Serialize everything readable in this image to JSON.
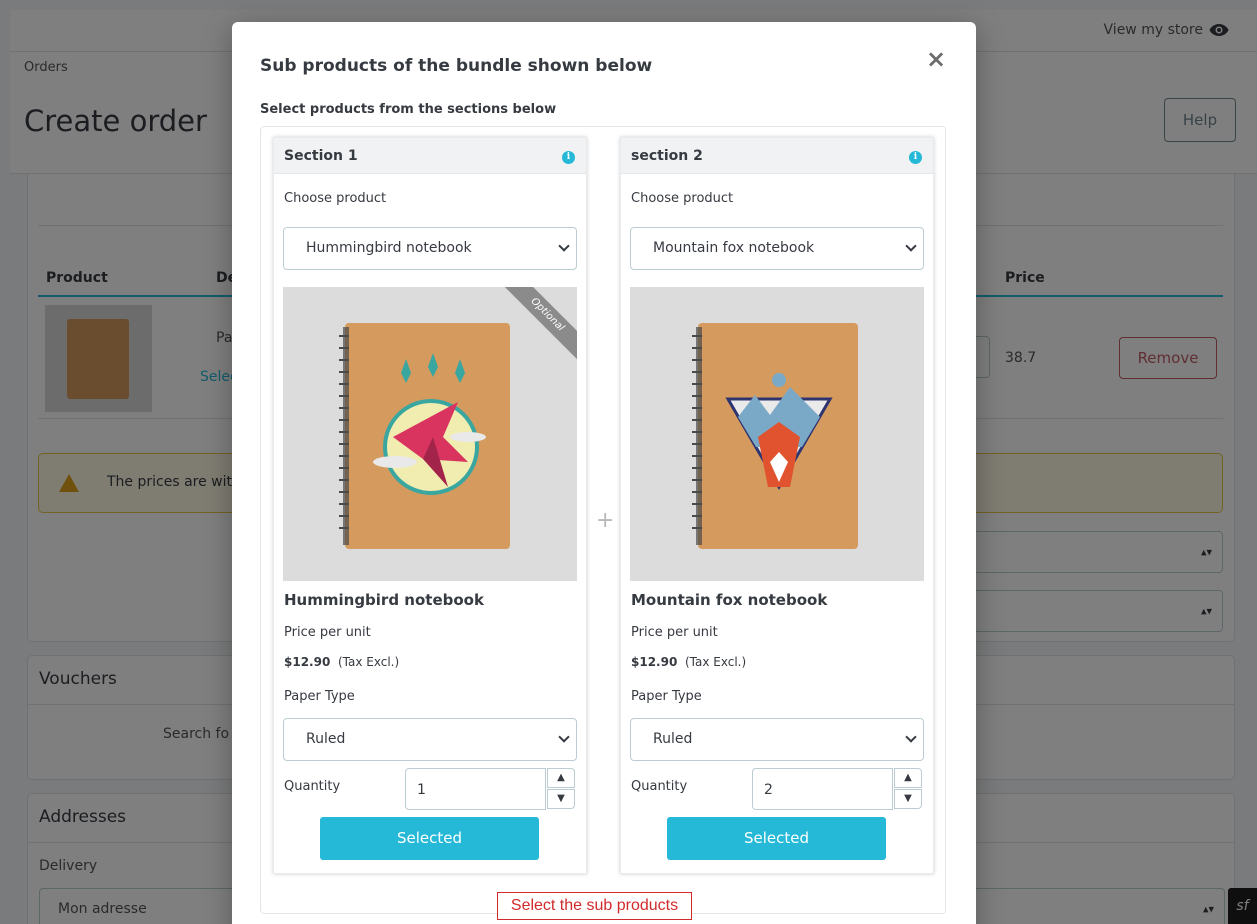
{
  "background": {
    "view_store": "View my store",
    "breadcrumb": "Orders",
    "page_title": "Create order",
    "help_button": "Help",
    "table_headers": {
      "product": "Product",
      "description": "De",
      "price": "Price"
    },
    "row": {
      "desc_text": "Pa",
      "select_link": "Selec",
      "price": "38.7",
      "remove_button": "Remove"
    },
    "alert_text": "The prices are wit",
    "vouchers_title": "Vouchers",
    "vouchers_search": "Search fo",
    "addresses_title": "Addresses",
    "delivery_label": "Delivery",
    "delivery_value": "Mon adresse"
  },
  "modal": {
    "title": "Sub products of the bundle shown below",
    "subtitle": "Select products from the sections below",
    "close_glyph": "×",
    "plus_glyph": "+",
    "hint": "Select the sub products",
    "sections": [
      {
        "title": "Section 1",
        "choose_label": "Choose product",
        "selected_product": "Hummingbird notebook",
        "ribbon": "Optional",
        "product_name": "Hummingbird notebook",
        "price_label": "Price per unit",
        "price": "$12.90",
        "tax_note": "(Tax Excl.)",
        "paper_label": "Paper Type",
        "paper_value": "Ruled",
        "quantity_label": "Quantity",
        "quantity": "1",
        "button": "Selected",
        "image_icon": "hummingbird-notebook-image"
      },
      {
        "title": "section 2",
        "choose_label": "Choose product",
        "selected_product": "Mountain fox notebook",
        "ribbon": "",
        "product_name": "Mountain fox notebook",
        "price_label": "Price per unit",
        "price": "$12.90",
        "tax_note": "(Tax Excl.)",
        "paper_label": "Paper Type",
        "paper_value": "Ruled",
        "quantity_label": "Quantity",
        "quantity": "2",
        "button": "Selected",
        "image_icon": "mountain-fox-notebook-image"
      }
    ]
  },
  "colors": {
    "accent": "#25b9d7",
    "danger": "#c05c67",
    "hint_red": "#d22a2a",
    "notebook": "#d59a5e"
  }
}
